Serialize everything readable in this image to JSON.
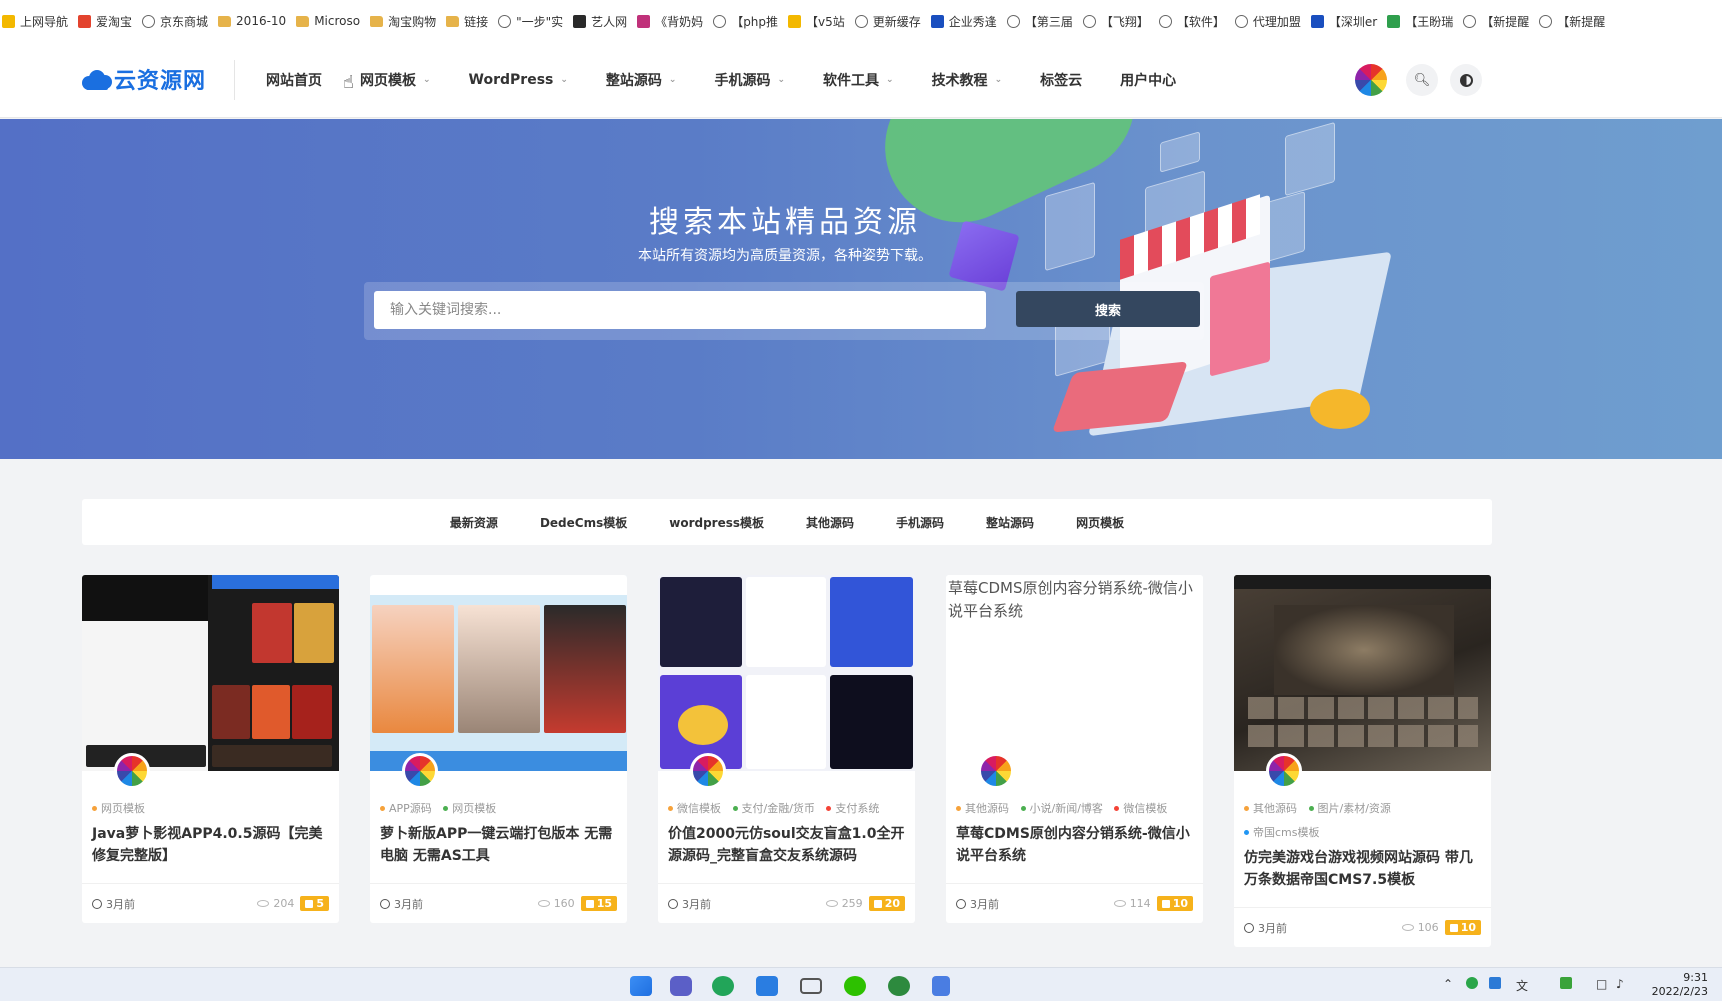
{
  "bookmarks": [
    {
      "label": "上网导航",
      "icon": "yellow-dot-icon"
    },
    {
      "label": "爱淘宝",
      "icon": "taobao-icon"
    },
    {
      "label": "京东商城",
      "icon": "globe-icon"
    },
    {
      "label": "2016-10",
      "icon": "folder-icon"
    },
    {
      "label": "Microso",
      "icon": "folder-icon"
    },
    {
      "label": "淘宝购物",
      "icon": "folder-icon"
    },
    {
      "label": "链接",
      "icon": "folder-icon"
    },
    {
      "label": "\"一步\"实",
      "icon": "globe-icon"
    },
    {
      "label": "艺人网",
      "icon": "dark-icon"
    },
    {
      "label": "《背奶妈",
      "icon": "purple-icon"
    },
    {
      "label": "【php推",
      "icon": "globe-icon"
    },
    {
      "label": "【v5站",
      "icon": "yellow-icon"
    },
    {
      "label": "更新缓存",
      "icon": "globe-icon"
    },
    {
      "label": "企业秀逢",
      "icon": "blue-icon"
    },
    {
      "label": "【第三届",
      "icon": "globe-icon"
    },
    {
      "label": "【飞翔】",
      "icon": "globe-icon"
    },
    {
      "label": "【软件】",
      "icon": "globe-icon"
    },
    {
      "label": "代理加盟",
      "icon": "globe-icon"
    },
    {
      "label": "【深圳er",
      "icon": "blue-icon"
    },
    {
      "label": "【王盼瑞",
      "icon": "green-icon"
    },
    {
      "label": "【新提醒",
      "icon": "globe-icon"
    },
    {
      "label": "【新提醒",
      "icon": "globe-icon"
    }
  ],
  "header": {
    "logo": "云资源网",
    "nav": [
      {
        "label": "网站首页",
        "dropdown": false
      },
      {
        "label": "网页模板",
        "dropdown": true
      },
      {
        "label": "WordPress",
        "dropdown": true
      },
      {
        "label": "整站源码",
        "dropdown": true
      },
      {
        "label": "手机源码",
        "dropdown": true
      },
      {
        "label": "软件工具",
        "dropdown": true
      },
      {
        "label": "技术教程",
        "dropdown": true
      },
      {
        "label": "标签云",
        "dropdown": false
      },
      {
        "label": "用户中心",
        "dropdown": false
      }
    ]
  },
  "hero": {
    "title": "搜索本站精品资源",
    "subtitle": "本站所有资源均为高质量资源，各种姿势下载。",
    "search_placeholder": "输入关键词搜索...",
    "search_button": "搜索"
  },
  "categories": [
    "最新资源",
    "DedeCms模板",
    "wordpress模板",
    "其他源码",
    "手机源码",
    "整站源码",
    "网页模板"
  ],
  "cards": [
    {
      "tags": [
        {
          "label": "网页模板",
          "color": "#f6a23b"
        }
      ],
      "title": "Java萝卜影视APP4.0.5源码【完美修复完整版】",
      "time": "3月前",
      "views": "204",
      "comments": "5"
    },
    {
      "tags": [
        {
          "label": "APP源码",
          "color": "#f6a23b"
        },
        {
          "label": "网页模板",
          "color": "#4caf50"
        }
      ],
      "title": "萝卜新版APP一键云端打包版本 无需电脑 无需AS工具",
      "time": "3月前",
      "views": "160",
      "comments": "15"
    },
    {
      "tags": [
        {
          "label": "微信模板",
          "color": "#f6a23b"
        },
        {
          "label": "支付/金融/货币",
          "color": "#4caf50"
        },
        {
          "label": "支付系统",
          "color": "#f44336"
        }
      ],
      "title": "价值2000元仿soul交友盲盒1.0全开源源码_完整盲盒交友系统源码",
      "time": "3月前",
      "views": "259",
      "comments": "20"
    },
    {
      "tags": [
        {
          "label": "其他源码",
          "color": "#f6a23b"
        },
        {
          "label": "小说/新闻/博客",
          "color": "#4caf50"
        },
        {
          "label": "微信模板",
          "color": "#f44336"
        }
      ],
      "title": "草莓CDMS原创内容分销系统-微信小说平台系统",
      "thumb_alt": "草莓CDMS原创内容分销系统-微信小说平台系统",
      "time": "3月前",
      "views": "114",
      "comments": "10"
    },
    {
      "tags": [
        {
          "label": "其他源码",
          "color": "#f6a23b"
        },
        {
          "label": "图片/素材/资源",
          "color": "#4caf50"
        },
        {
          "label": "帝国cms模板",
          "color": "#2196f3"
        }
      ],
      "title": "仿完美游戏台游戏视频网站源码 带几万条数据帝国CMS7.5模板",
      "time": "3月前",
      "views": "106",
      "comments": "10"
    }
  ],
  "taskbar": {
    "time": "9:31",
    "date": "2022/2/23"
  },
  "colors": {
    "brand": "#1a6fe0",
    "hero_start": "#5470c6",
    "hero_end": "#6f9ecf",
    "search_button": "#34475f",
    "comment_badge": "#f6b21b"
  }
}
